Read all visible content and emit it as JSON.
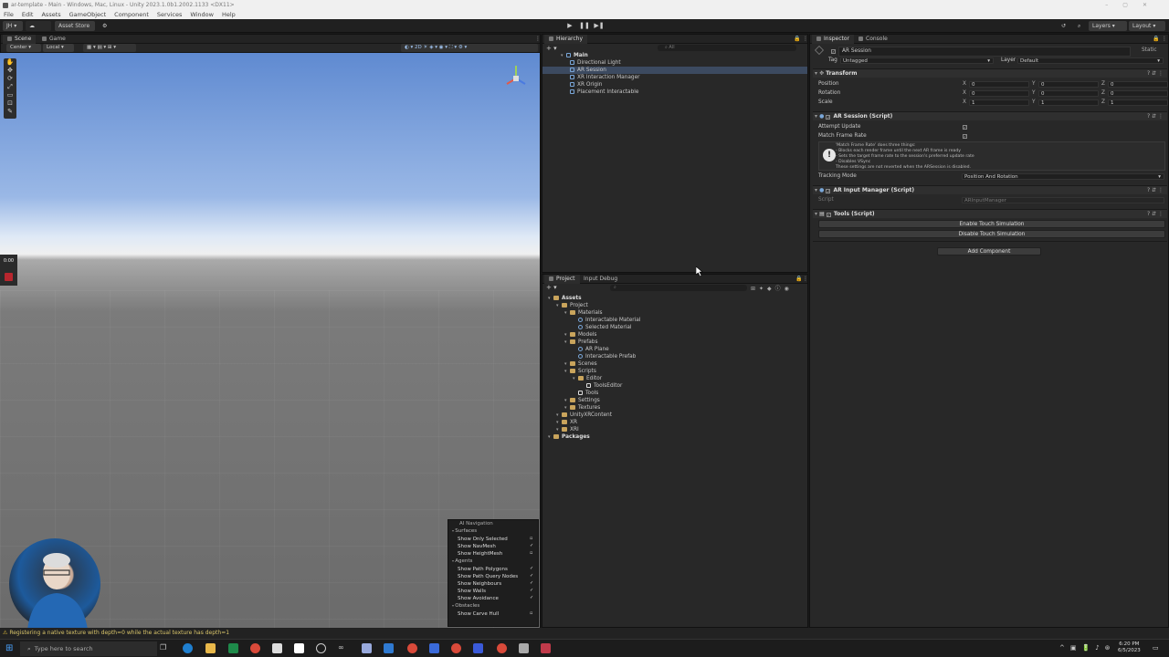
{
  "title": "ar-template - Main - Windows, Mac, Linux - Unity 2023.1.0b1.2002.1133 <DX11>",
  "menu": [
    "File",
    "Edit",
    "Assets",
    "GameObject",
    "Component",
    "Services",
    "Window",
    "Help"
  ],
  "toolbar": {
    "account": "JH",
    "asset_store": "Asset Store",
    "layers": "Layers",
    "layout": "Layout",
    "center": "Center",
    "local": "Local"
  },
  "scene_tabs": [
    "Scene",
    "Game"
  ],
  "recorder_time": "0:00",
  "hierarchy": {
    "tab": "Hierarchy",
    "search_placeholder": "All",
    "scene": "Main",
    "items": [
      "Directional Light",
      "AR Session",
      "XR Interaction Manager",
      "XR Origin",
      "Placement Interactable"
    ],
    "selected": "AR Session"
  },
  "project": {
    "tabs": [
      "Project",
      "Input Debug"
    ],
    "tree": [
      {
        "label": "Assets",
        "type": "folder",
        "depth": 0
      },
      {
        "label": "Project",
        "type": "folder",
        "depth": 1
      },
      {
        "label": "Materials",
        "type": "folder",
        "depth": 2
      },
      {
        "label": "Interactable Material",
        "type": "asset",
        "depth": 3
      },
      {
        "label": "Selected Material",
        "type": "asset",
        "depth": 3
      },
      {
        "label": "Models",
        "type": "folder",
        "depth": 2
      },
      {
        "label": "Prefabs",
        "type": "folder",
        "depth": 2
      },
      {
        "label": "AR Plane",
        "type": "asset",
        "depth": 3
      },
      {
        "label": "Interactable Prefab",
        "type": "asset",
        "depth": 3
      },
      {
        "label": "Scenes",
        "type": "folder",
        "depth": 2
      },
      {
        "label": "Scripts",
        "type": "folder",
        "depth": 2
      },
      {
        "label": "Editor",
        "type": "folder",
        "depth": 3
      },
      {
        "label": "ToolsEditor",
        "type": "script",
        "depth": 4
      },
      {
        "label": "Tools",
        "type": "script",
        "depth": 3
      },
      {
        "label": "Settings",
        "type": "folder",
        "depth": 2
      },
      {
        "label": "Textures",
        "type": "folder",
        "depth": 2
      },
      {
        "label": "UnityXRContent",
        "type": "folder",
        "depth": 1
      },
      {
        "label": "XR",
        "type": "folder",
        "depth": 1
      },
      {
        "label": "XRI",
        "type": "folder",
        "depth": 1
      },
      {
        "label": "Packages",
        "type": "folder",
        "depth": 0
      }
    ]
  },
  "inspector": {
    "tabs": [
      "Inspector",
      "Console"
    ],
    "object_name": "AR Session",
    "static": "Static",
    "tag_label": "Tag",
    "tag": "Untagged",
    "layer_label": "Layer",
    "layer": "Default",
    "transform": {
      "title": "Transform",
      "rows": [
        {
          "label": "Position",
          "x": "0",
          "y": "0",
          "z": "0"
        },
        {
          "label": "Rotation",
          "x": "0",
          "y": "0",
          "z": "0"
        },
        {
          "label": "Scale",
          "x": "1",
          "y": "1",
          "z": "1"
        }
      ]
    },
    "ar_session": {
      "title": "AR Session (Script)",
      "attempt_update": "Attempt Update",
      "match_frame_rate": "Match Frame Rate",
      "help": [
        "'Match Frame Rate' does three things:",
        "- Blocks each render frame until the next AR frame is ready",
        "- Sets the target frame rate to the session's preferred update rate",
        "- Disables VSync",
        "These settings are not reverted when the ARSession is disabled."
      ],
      "tracking_mode_label": "Tracking Mode",
      "tracking_mode": "Position And Rotation"
    },
    "ar_input": {
      "title": "AR Input Manager (Script)",
      "script_label": "Script",
      "script": "ARInputManager"
    },
    "tools": {
      "title": "Tools (Script)",
      "enable": "Enable Touch Simulation",
      "disable": "Disable Touch Simulation"
    },
    "add_component": "Add Component"
  },
  "ai_nav": {
    "title": "AI Navigation",
    "items": [
      {
        "label": "Surfaces",
        "type": "header"
      },
      {
        "label": "Show Only Selected",
        "checked": false
      },
      {
        "label": "Show NavMesh",
        "checked": true
      },
      {
        "label": "Show HeightMesh",
        "checked": false
      },
      {
        "label": "Agents",
        "type": "header"
      },
      {
        "label": "Show Path Polygons",
        "checked": true
      },
      {
        "label": "Show Path Query Nodes",
        "checked": true
      },
      {
        "label": "Show Neighbours",
        "checked": true
      },
      {
        "label": "Show Walls",
        "checked": true
      },
      {
        "label": "Show Avoidance",
        "checked": true
      },
      {
        "label": "Obstacles",
        "type": "header"
      },
      {
        "label": "Show Carve Hull",
        "checked": false
      }
    ]
  },
  "status_message": "Registering a native texture with depth=0 while the actual texture has depth=1",
  "taskbar": {
    "search": "Type here to search",
    "time": "6:20 PM",
    "date": "6/5/2023"
  }
}
